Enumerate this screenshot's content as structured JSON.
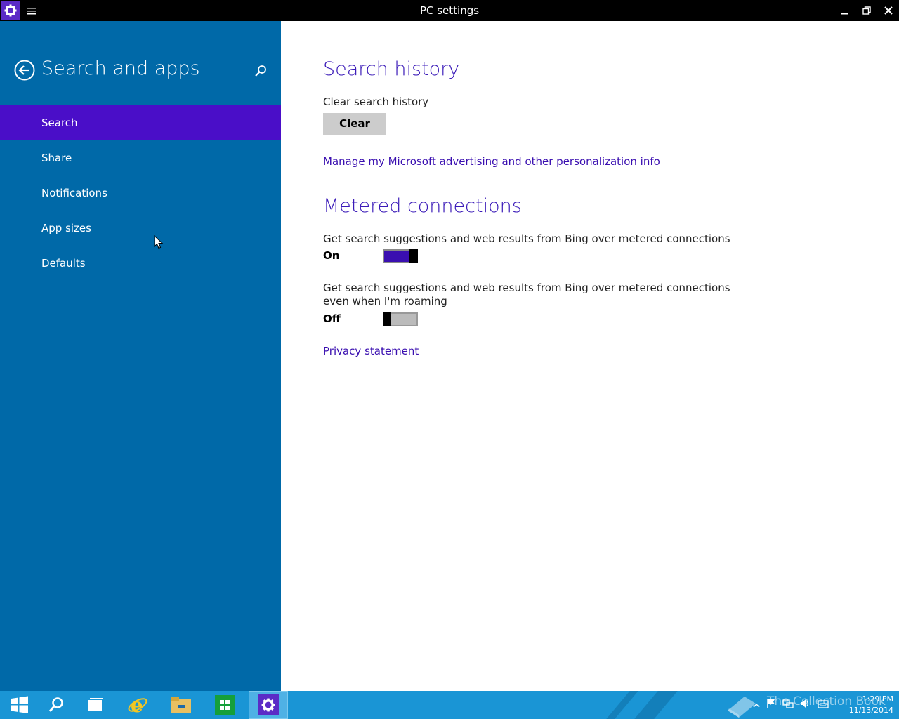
{
  "window": {
    "title": "PC settings"
  },
  "sidebar": {
    "heading": "Search and apps",
    "items": [
      {
        "label": "Search",
        "selected": true
      },
      {
        "label": "Share",
        "selected": false
      },
      {
        "label": "Notifications",
        "selected": false
      },
      {
        "label": "App sizes",
        "selected": false
      },
      {
        "label": "Defaults",
        "selected": false
      }
    ]
  },
  "main": {
    "search_history": {
      "title": "Search history",
      "clear_label": "Clear search history",
      "clear_button": "Clear",
      "manage_link": "Manage my Microsoft advertising and other personalization info"
    },
    "metered": {
      "title": "Metered connections",
      "setting1": {
        "label": "Get search suggestions and web results from Bing over metered connections",
        "state": "On",
        "value": true
      },
      "setting2": {
        "label": "Get search suggestions and web results from Bing over metered connections even when I'm roaming",
        "state": "Off",
        "value": false
      },
      "privacy_link": "Privacy statement"
    }
  },
  "taskbar": {
    "items": [
      "start-icon",
      "search-icon",
      "task-view-icon",
      "internet-explorer-icon",
      "file-explorer-icon",
      "store-icon",
      "settings-icon"
    ],
    "watermark": "The Collection Book",
    "time": "1:29 PM",
    "date": "11/13/2014"
  },
  "colors": {
    "sidebar": "#0069a8",
    "selected": "#4a0ec8",
    "accent": "#3a1ab8",
    "taskbar": "#1a95d5"
  }
}
